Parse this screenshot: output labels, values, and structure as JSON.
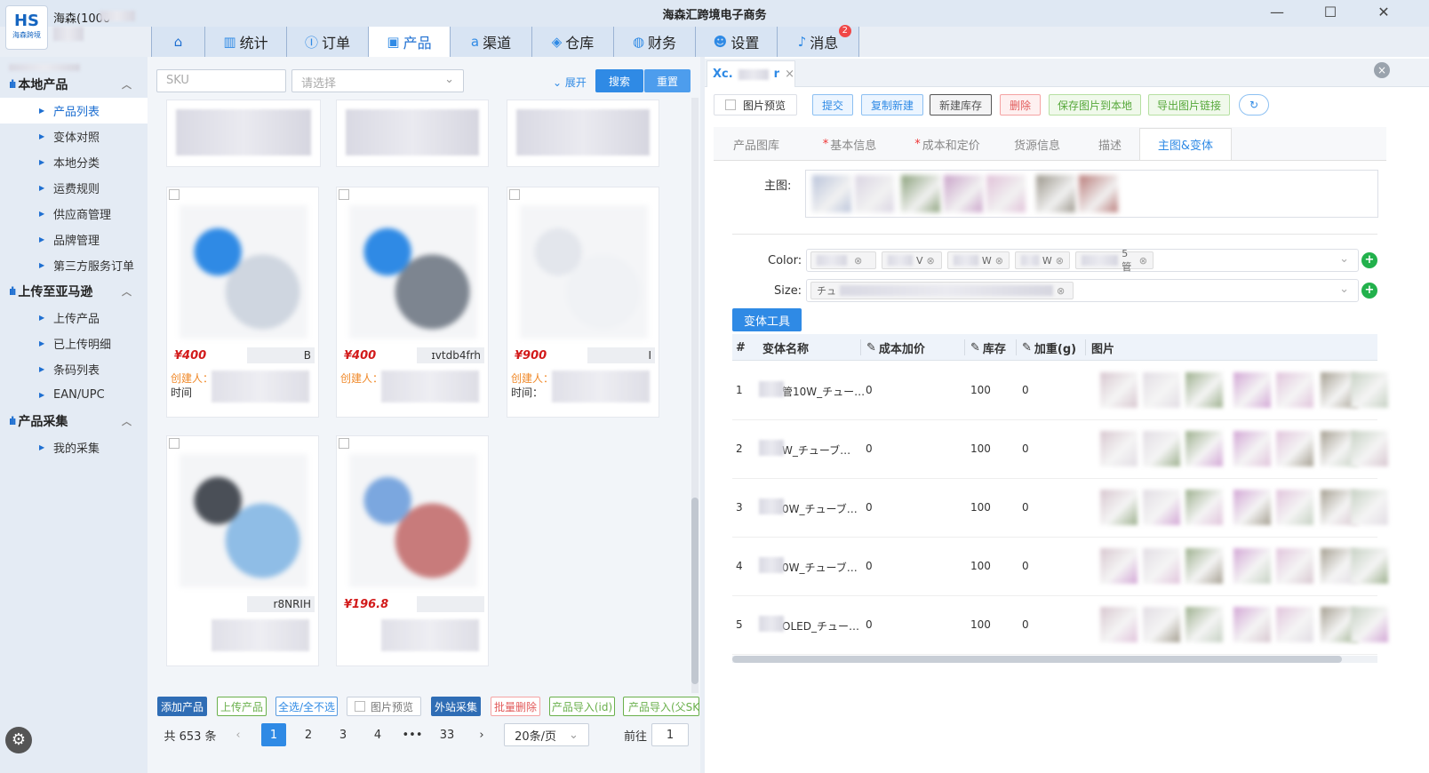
{
  "window": {
    "title": "海森汇跨境电子商务",
    "user": "海森(1000",
    "logo_text": "HS",
    "logo_sub": "海森跨境"
  },
  "nav": {
    "tabs": [
      {
        "label": "",
        "icon": "home-icon",
        "glyph": "⌂"
      },
      {
        "label": "统计",
        "icon": "chart-icon",
        "glyph": "▥"
      },
      {
        "label": "订单",
        "icon": "order-icon",
        "glyph": "Ⓘ"
      },
      {
        "label": "产品",
        "icon": "box-icon",
        "glyph": "▣"
      },
      {
        "label": "渠道",
        "icon": "amazon-icon",
        "glyph": "a"
      },
      {
        "label": "仓库",
        "icon": "warehouse-icon",
        "glyph": "◈"
      },
      {
        "label": "财务",
        "icon": "money-bag-icon",
        "glyph": "◍"
      },
      {
        "label": "设置",
        "icon": "user-settings-icon",
        "glyph": "☻"
      },
      {
        "label": "消息",
        "icon": "bell-icon",
        "glyph": "♪"
      }
    ],
    "active_index": 3,
    "message_badge": "2"
  },
  "sidebar": {
    "groups": [
      {
        "label": "本地产品",
        "items": [
          "产品列表",
          "变体对照",
          "本地分类",
          "运费规则",
          "供应商管理",
          "品牌管理",
          "第三方服务订单"
        ]
      },
      {
        "label": "上传至亚马逊",
        "items": [
          "上传产品",
          "已上传明细",
          "条码列表",
          "EAN/UPC"
        ]
      },
      {
        "label": "产品采集",
        "items": [
          "我的采集"
        ]
      }
    ],
    "active_item": "产品列表"
  },
  "search": {
    "sku_placeholder": "SKU",
    "select_placeholder": "请选择",
    "expand_label": "展开",
    "search_label": "搜索",
    "reset_label": "重置"
  },
  "products": [
    {
      "price": "¥400",
      "code": "B",
      "creator_label": "创建人：",
      "time_label": "时间"
    },
    {
      "price": "¥400",
      "code": "ɪvtdb4frh",
      "creator_label": "创建人：",
      "time_label": ""
    },
    {
      "price": "¥900",
      "code": "I",
      "creator_label": "创建人：",
      "time_label": "时间："
    },
    {
      "price": "",
      "code": "r8NRIH",
      "creator_label": "",
      "time_label": ""
    },
    {
      "price": "¥196.8",
      "code": "",
      "creator_label": "",
      "time_label": ""
    }
  ],
  "bottom_toolbar": [
    "添加产品",
    "上传产品",
    "全选/全不选",
    "图片预览",
    "外站采集",
    "批量删除",
    "产品导入(id)",
    "产品导入(父SKU"
  ],
  "pagination": {
    "total": "共 653 条",
    "pages": [
      "1",
      "2",
      "3",
      "4",
      "•••",
      "33"
    ],
    "current": "1",
    "page_size": "20条/页",
    "goto_label": "前往",
    "goto_value": "1",
    "prev": "‹",
    "next": "›"
  },
  "detail": {
    "tab_title": "Xc.",
    "tab_title_tail": "r",
    "toolbar": [
      "图片预览",
      "提交",
      "复制新建",
      "新建库存",
      "删除",
      "保存图片到本地",
      "导出图片链接",
      "↻"
    ],
    "tabs": [
      "产品图库",
      "基本信息",
      "成本和定价",
      "货源信息",
      "描述",
      "主图&变体"
    ],
    "required_tabs": [
      "基本信息",
      "成本和定价"
    ],
    "active_tab": "主图&变体",
    "main_image_label": "主图:",
    "color_label": "Color:",
    "color_tags": [
      "",
      "V",
      "W",
      "W",
      "5管"
    ],
    "size_label": "Size:",
    "size_prefix": "チュ",
    "variant_tool_label": "变体工具",
    "columns": [
      "#",
      "变体名称",
      "成本加价",
      "库存",
      "加重(g)",
      "图片"
    ],
    "rows": [
      {
        "idx": "1",
        "name": "管10W_チュー…",
        "cost": "0",
        "stock": "100",
        "weight": "0"
      },
      {
        "idx": "2",
        "name": "W_チューブ…",
        "cost": "0",
        "stock": "100",
        "weight": "0"
      },
      {
        "idx": "3",
        "name": "0W_チューブ…",
        "cost": "0",
        "stock": "100",
        "weight": "0"
      },
      {
        "idx": "4",
        "name": "0W_チューブ…",
        "cost": "0",
        "stock": "100",
        "weight": "0"
      },
      {
        "idx": "5",
        "name": "OLED_チュー…",
        "cost": "0",
        "stock": "100",
        "weight": "0"
      }
    ]
  },
  "colors": {
    "accent": "#2f8ae5",
    "price": "#d21a1a",
    "creator": "#f0892a",
    "add_green": "#22b14c",
    "danger": "#f04747"
  }
}
